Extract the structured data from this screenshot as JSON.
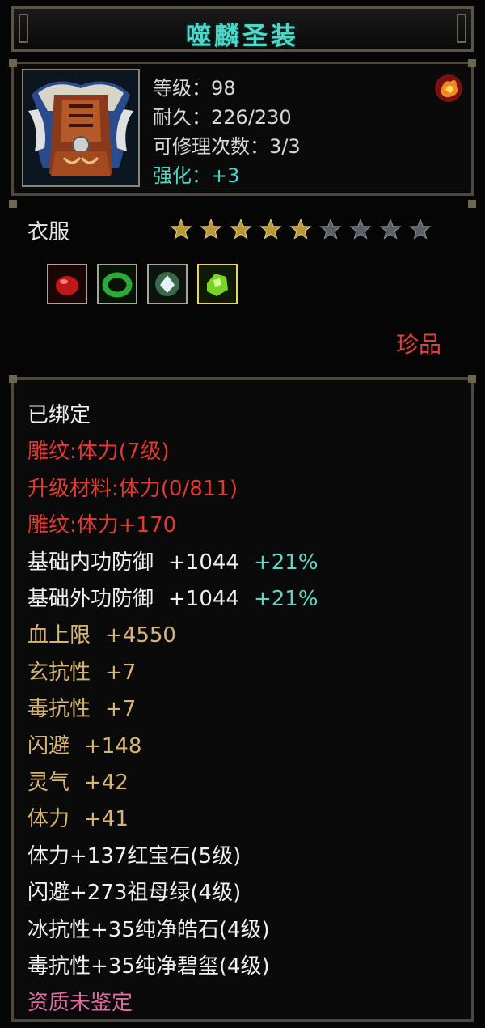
{
  "title": "噬麟圣装",
  "header": {
    "level_label": "等级：",
    "level_value": "98",
    "durability_label": "耐久：",
    "durability_value": "226/230",
    "repair_label": "可修理次数：",
    "repair_value": "3/3",
    "enhance_label": "强化：",
    "enhance_value": "+3"
  },
  "category": "衣服",
  "stars": {
    "filled": 5,
    "total": 9
  },
  "gems": [
    "red-gem-icon",
    "jade-ring-icon",
    "white-crystal-icon",
    "green-gem-icon"
  ],
  "rarity": "珍品",
  "lines": [
    {
      "text": "已绑定",
      "color": "white"
    },
    {
      "text": "雕纹:体力(7级)",
      "color": "red"
    },
    {
      "text": "升级材料:体力(0/811)",
      "color": "red"
    },
    {
      "text": "雕纹:体力+170",
      "color": "red"
    },
    {
      "text": "基础内功防御",
      "value": "+1044",
      "pct": "+21%",
      "color": "white"
    },
    {
      "text": "基础外功防御",
      "value": "+1044",
      "pct": "+21%",
      "color": "white"
    },
    {
      "text": "血上限",
      "value": "+4550",
      "color": "gold"
    },
    {
      "text": "玄抗性",
      "value": "+7",
      "color": "gold"
    },
    {
      "text": "毒抗性",
      "value": "+7",
      "color": "gold"
    },
    {
      "text": "闪避",
      "value": "+148",
      "color": "gold"
    },
    {
      "text": "灵气",
      "value": "+42",
      "color": "gold"
    },
    {
      "text": "体力",
      "value": "+41",
      "color": "gold"
    },
    {
      "text": "体力+137红宝石(5级)",
      "color": "white"
    },
    {
      "text": "闪避+273祖母绿(4级)",
      "color": "white"
    },
    {
      "text": "冰抗性+35纯净皓石(4级)",
      "color": "white"
    },
    {
      "text": "毒抗性+35纯净碧玺(4级)",
      "color": "white"
    },
    {
      "text": "资质未鉴定",
      "color": "pink"
    }
  ],
  "colors": {
    "title": "#4fd6c6",
    "red": "#e03a32",
    "gold": "#d8b574",
    "cyan": "#4fd6c6",
    "pink": "#e06aa0"
  }
}
